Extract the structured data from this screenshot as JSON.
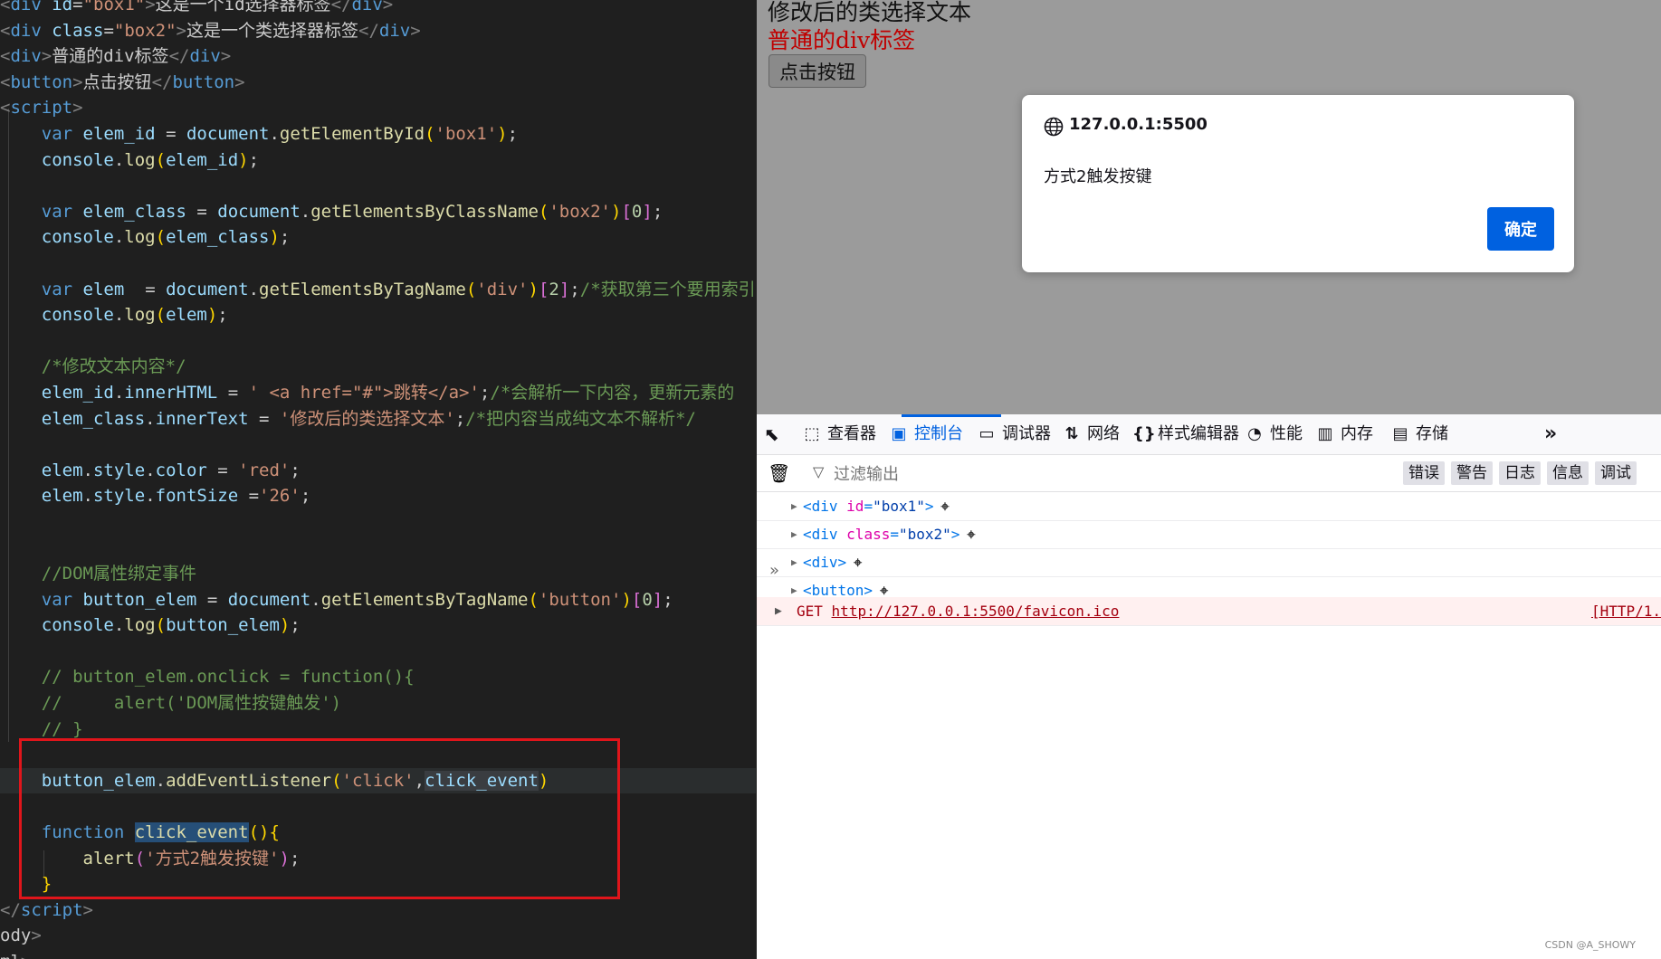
{
  "editor": {
    "code_lines": [
      [
        [
          "tag",
          "<"
        ],
        [
          "tn",
          "div"
        ],
        [
          "pun",
          " "
        ],
        [
          "attr",
          "id"
        ],
        [
          "pun",
          "="
        ],
        [
          "str",
          "\"box1\""
        ],
        [
          "tag",
          ">"
        ],
        [
          "pun",
          "这是一个id选择器标签"
        ],
        [
          "tag",
          "</"
        ],
        [
          "tn",
          "div"
        ],
        [
          "tag",
          ">"
        ]
      ],
      [
        [
          "tag",
          "<"
        ],
        [
          "tn",
          "div"
        ],
        [
          "pun",
          " "
        ],
        [
          "attr",
          "class"
        ],
        [
          "pun",
          "="
        ],
        [
          "str",
          "\"box2\""
        ],
        [
          "tag",
          ">"
        ],
        [
          "pun",
          "这是一个类选择器标签"
        ],
        [
          "tag",
          "</"
        ],
        [
          "tn",
          "div"
        ],
        [
          "tag",
          ">"
        ]
      ],
      [
        [
          "tag",
          "<"
        ],
        [
          "tn",
          "div"
        ],
        [
          "tag",
          ">"
        ],
        [
          "pun",
          "普通的div标签"
        ],
        [
          "tag",
          "</"
        ],
        [
          "tn",
          "div"
        ],
        [
          "tag",
          ">"
        ]
      ],
      [
        [
          "tag",
          "<"
        ],
        [
          "tn",
          "button"
        ],
        [
          "tag",
          ">"
        ],
        [
          "pun",
          "点击按钮"
        ],
        [
          "tag",
          "</"
        ],
        [
          "tn",
          "button"
        ],
        [
          "tag",
          ">"
        ]
      ],
      [
        [
          "tag",
          "<"
        ],
        [
          "tn",
          "script"
        ],
        [
          "tag",
          ">"
        ]
      ],
      [
        [
          "pun",
          "    "
        ],
        [
          "kw",
          "var"
        ],
        [
          "pun",
          " "
        ],
        [
          "var",
          "elem_id"
        ],
        [
          "pun",
          " = "
        ],
        [
          "var",
          "document"
        ],
        [
          "pun",
          "."
        ],
        [
          "fn",
          "getElementById"
        ],
        [
          "br",
          "("
        ],
        [
          "str",
          "'box1'"
        ],
        [
          "br",
          ")"
        ],
        [
          "pun",
          ";"
        ]
      ],
      [
        [
          "pun",
          "    "
        ],
        [
          "var",
          "console"
        ],
        [
          "pun",
          "."
        ],
        [
          "fn",
          "log"
        ],
        [
          "br",
          "("
        ],
        [
          "var",
          "elem_id"
        ],
        [
          "br",
          ")"
        ],
        [
          "pun",
          ";"
        ]
      ],
      [],
      [
        [
          "pun",
          "    "
        ],
        [
          "kw",
          "var"
        ],
        [
          "pun",
          " "
        ],
        [
          "var",
          "elem_class"
        ],
        [
          "pun",
          " = "
        ],
        [
          "var",
          "document"
        ],
        [
          "pun",
          "."
        ],
        [
          "fn",
          "getElementsByClassName"
        ],
        [
          "br",
          "("
        ],
        [
          "str",
          "'box2'"
        ],
        [
          "br",
          ")"
        ],
        [
          "br2",
          "["
        ],
        [
          "num",
          "0"
        ],
        [
          "br2",
          "]"
        ],
        [
          "pun",
          ";"
        ]
      ],
      [
        [
          "pun",
          "    "
        ],
        [
          "var",
          "console"
        ],
        [
          "pun",
          "."
        ],
        [
          "fn",
          "log"
        ],
        [
          "br",
          "("
        ],
        [
          "var",
          "elem_class"
        ],
        [
          "br",
          ")"
        ],
        [
          "pun",
          ";"
        ]
      ],
      [],
      [
        [
          "pun",
          "    "
        ],
        [
          "kw",
          "var"
        ],
        [
          "pun",
          " "
        ],
        [
          "var",
          "elem"
        ],
        [
          "pun",
          "  = "
        ],
        [
          "var",
          "document"
        ],
        [
          "pun",
          "."
        ],
        [
          "fn",
          "getElementsByTagName"
        ],
        [
          "br",
          "("
        ],
        [
          "str",
          "'div'"
        ],
        [
          "br",
          ")"
        ],
        [
          "br2",
          "["
        ],
        [
          "num",
          "2"
        ],
        [
          "br2",
          "]"
        ],
        [
          "pun",
          ";"
        ],
        [
          "com",
          "/*获取第三个要用索引"
        ]
      ],
      [
        [
          "pun",
          "    "
        ],
        [
          "var",
          "console"
        ],
        [
          "pun",
          "."
        ],
        [
          "fn",
          "log"
        ],
        [
          "br",
          "("
        ],
        [
          "var",
          "elem"
        ],
        [
          "br",
          ")"
        ],
        [
          "pun",
          ";"
        ]
      ],
      [],
      [
        [
          "pun",
          "    "
        ],
        [
          "com",
          "/*修改文本内容*/"
        ]
      ],
      [
        [
          "pun",
          "    "
        ],
        [
          "var",
          "elem_id"
        ],
        [
          "pun",
          "."
        ],
        [
          "var",
          "innerHTML"
        ],
        [
          "pun",
          " = "
        ],
        [
          "str",
          "' <a href=\"#\">跳转</a>'"
        ],
        [
          "pun",
          ";"
        ],
        [
          "com",
          "/*会解析一下内容，更新元素的"
        ]
      ],
      [
        [
          "pun",
          "    "
        ],
        [
          "var",
          "elem_class"
        ],
        [
          "pun",
          "."
        ],
        [
          "var",
          "innerText"
        ],
        [
          "pun",
          " = "
        ],
        [
          "str",
          "'修改后的类选择文本'"
        ],
        [
          "pun",
          ";"
        ],
        [
          "com",
          "/*把内容当成纯文本不解析*/"
        ]
      ],
      [],
      [
        [
          "pun",
          "    "
        ],
        [
          "var",
          "elem"
        ],
        [
          "pun",
          "."
        ],
        [
          "var",
          "style"
        ],
        [
          "pun",
          "."
        ],
        [
          "var",
          "color"
        ],
        [
          "pun",
          " = "
        ],
        [
          "str",
          "'red'"
        ],
        [
          "pun",
          ";"
        ]
      ],
      [
        [
          "pun",
          "    "
        ],
        [
          "var",
          "elem"
        ],
        [
          "pun",
          "."
        ],
        [
          "var",
          "style"
        ],
        [
          "pun",
          "."
        ],
        [
          "var",
          "fontSize"
        ],
        [
          "pun",
          " ="
        ],
        [
          "str",
          "'26'"
        ],
        [
          "pun",
          ";"
        ]
      ],
      [],
      [],
      [
        [
          "pun",
          "    "
        ],
        [
          "com",
          "//DOM属性绑定事件"
        ]
      ],
      [
        [
          "pun",
          "    "
        ],
        [
          "kw",
          "var"
        ],
        [
          "pun",
          " "
        ],
        [
          "var",
          "button_elem"
        ],
        [
          "pun",
          " = "
        ],
        [
          "var",
          "document"
        ],
        [
          "pun",
          "."
        ],
        [
          "fn",
          "getElementsByTagName"
        ],
        [
          "br",
          "("
        ],
        [
          "str",
          "'button'"
        ],
        [
          "br",
          ")"
        ],
        [
          "br2",
          "["
        ],
        [
          "num",
          "0"
        ],
        [
          "br2",
          "]"
        ],
        [
          "pun",
          ";"
        ]
      ],
      [
        [
          "pun",
          "    "
        ],
        [
          "var",
          "console"
        ],
        [
          "pun",
          "."
        ],
        [
          "fn",
          "log"
        ],
        [
          "br",
          "("
        ],
        [
          "var",
          "button_elem"
        ],
        [
          "br",
          ")"
        ],
        [
          "pun",
          ";"
        ]
      ],
      [],
      [
        [
          "pun",
          "    "
        ],
        [
          "com",
          "// button_elem.onclick = function(){"
        ]
      ],
      [
        [
          "pun",
          "    "
        ],
        [
          "com",
          "//     alert('DOM属性按键触发')"
        ]
      ],
      [
        [
          "pun",
          "    "
        ],
        [
          "com",
          "// }"
        ]
      ],
      [],
      [
        [
          "pun",
          "    "
        ],
        [
          "var",
          "button_elem"
        ],
        [
          "pun",
          "."
        ],
        [
          "fn",
          "addEventListener"
        ],
        [
          "br",
          "("
        ],
        [
          "str",
          "'click'"
        ],
        [
          "pun",
          ","
        ],
        [
          "hl",
          "click_event"
        ],
        [
          "br",
          ")"
        ]
      ],
      [],
      [
        [
          "pun",
          "    "
        ],
        [
          "kw",
          "function"
        ],
        [
          "pun",
          " "
        ],
        [
          "hl2",
          "click_event"
        ],
        [
          "br",
          "()"
        ],
        [
          "br",
          "{"
        ]
      ],
      [
        [
          "pun",
          "        "
        ],
        [
          "fn",
          "alert"
        ],
        [
          "br2",
          "("
        ],
        [
          "str",
          "'方式2触发按键'"
        ],
        [
          "br2",
          ")"
        ],
        [
          "pun",
          ";"
        ]
      ],
      [
        [
          "pun",
          "    "
        ],
        [
          "br",
          "}"
        ]
      ],
      [
        [
          "tag",
          "</"
        ],
        [
          "tn",
          "script"
        ],
        [
          "tag",
          ">"
        ]
      ],
      [
        [
          "pun",
          "ody"
        ],
        [
          "tag",
          ">"
        ]
      ],
      [
        [
          "pun",
          "ml"
        ],
        [
          "tag",
          ">"
        ]
      ]
    ]
  },
  "page": {
    "line1": "修改后的类选择文本",
    "line2": "普通的div标签",
    "button_label": "点击按钮"
  },
  "dialog": {
    "origin": "127.0.0.1:5500",
    "message": "方式2触发按键",
    "ok_label": "确定"
  },
  "devtools": {
    "tabs": [
      {
        "name": "inspector",
        "label": "查看器",
        "icon": "⬚"
      },
      {
        "name": "console",
        "label": "控制台",
        "icon": "▣",
        "active": true
      },
      {
        "name": "debugger",
        "label": "调试器",
        "icon": "▭"
      },
      {
        "name": "network",
        "label": "网络",
        "icon": "⇅"
      },
      {
        "name": "style-editor",
        "label": "样式编辑器",
        "icon": "{}"
      },
      {
        "name": "performance",
        "label": "性能",
        "icon": "◔"
      },
      {
        "name": "memory",
        "label": "内存",
        "icon": "▥"
      },
      {
        "name": "storage",
        "label": "存储",
        "icon": "▤"
      }
    ],
    "filter_placeholder": "过滤输出",
    "levels": [
      "错误",
      "警告",
      "日志",
      "信息",
      "调试"
    ],
    "rows": [
      [
        [
          "tag",
          "<div"
        ],
        [
          "sp",
          " "
        ],
        [
          "attr",
          "id"
        ],
        [
          "eq",
          "="
        ],
        [
          "val",
          "\"box1\""
        ],
        [
          "tag",
          ">"
        ]
      ],
      [
        [
          "tag",
          "<div"
        ],
        [
          "sp",
          " "
        ],
        [
          "attr",
          "class"
        ],
        [
          "eq",
          "="
        ],
        [
          "val",
          "\"box2\""
        ],
        [
          "tag",
          ">"
        ]
      ],
      [
        [
          "tag",
          "<div>"
        ]
      ],
      [
        [
          "tag",
          "<button>"
        ]
      ]
    ],
    "error": {
      "method": "GET",
      "url": "http://127.0.0.1:5500/favicon.ico",
      "status": "[HTTP/1."
    },
    "prompt": "»"
  },
  "watermark": "CSDN @A_SHOWY",
  "colors": {
    "accent": "#0061e0",
    "red_box": "#e0151b",
    "page_bg": "#9b9b9b",
    "red_text": "#c00000"
  }
}
